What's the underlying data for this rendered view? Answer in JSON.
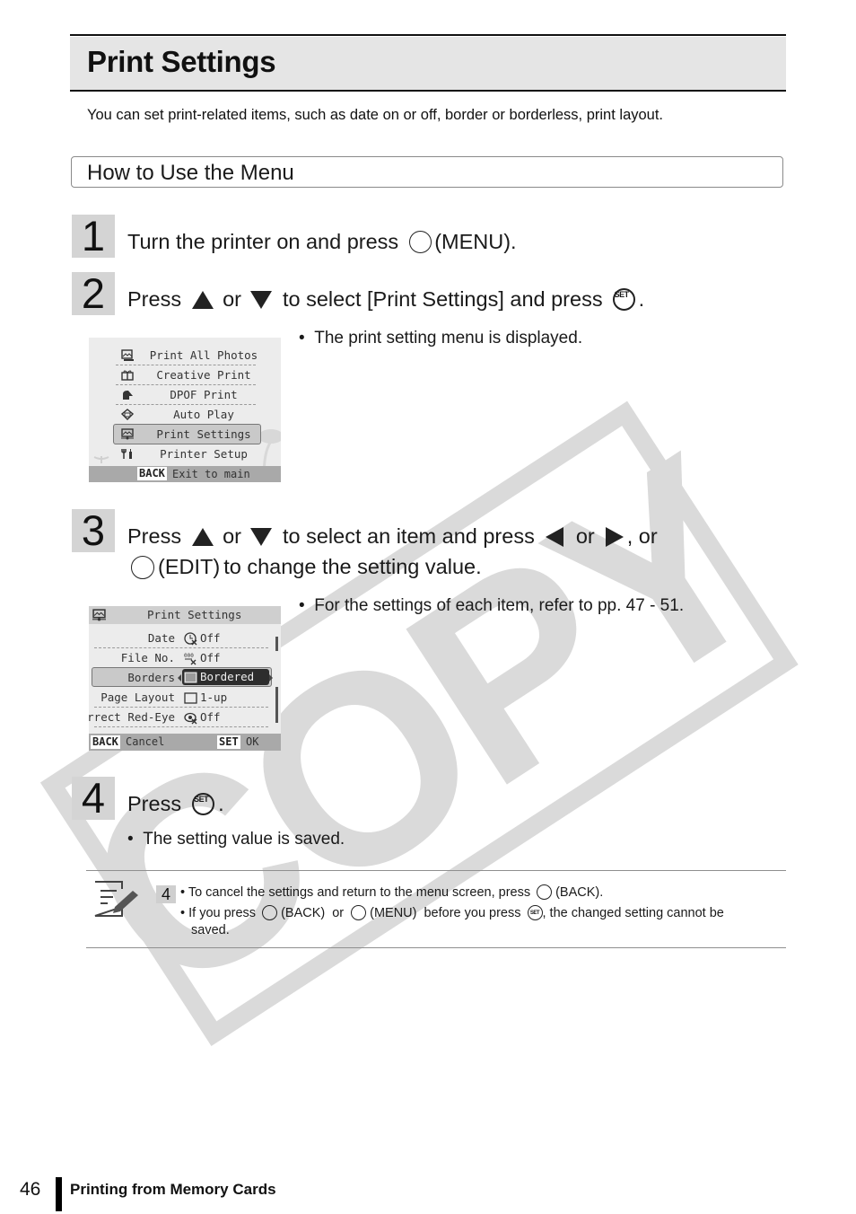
{
  "page": {
    "title": "Print Settings",
    "intro": "You can set print-related items, such as date on or off, border or borderless, print layout.",
    "section_title": "How to Use the Menu",
    "watermark": "COPY"
  },
  "steps": [
    {
      "number": "1",
      "parts": {
        "a": "Turn the printer on and press",
        "button_icon": "circle-button-icon",
        "b": "(MENU)."
      }
    },
    {
      "number": "2",
      "parts": {
        "a": "Press",
        "up_icon": "up-arrow-icon",
        "or1": "or",
        "down_icon": "down-arrow-icon",
        "b": "to select [Print Settings] and press",
        "set_icon": "set-button-icon",
        "c": "."
      },
      "bullet": "The print setting menu is displayed."
    },
    {
      "number": "3",
      "parts": {
        "a": "Press",
        "or1": "or",
        "b": "to select an item and press",
        "or2": "or",
        "c": ", or",
        "d": "(EDIT)",
        "e": "to change the setting value."
      },
      "bullet": "For the settings of each item, refer to pp. 47 - 51."
    },
    {
      "number": "4",
      "parts": {
        "a": "Press",
        "c": "."
      },
      "bullet": "The setting value is saved."
    }
  ],
  "screen1": {
    "items": [
      {
        "label": "Print All Photos",
        "icon": "photos-icon"
      },
      {
        "label": "Creative Print",
        "icon": "gift-icon"
      },
      {
        "label": "DPOF Print",
        "icon": "dpof-icon"
      },
      {
        "label": "Auto Play",
        "icon": "auto-play-icon"
      },
      {
        "label": "Print Settings",
        "icon": "print-settings-icon",
        "selected": true
      },
      {
        "label": "Printer Setup",
        "icon": "tools-icon"
      }
    ],
    "footer_key": "BACK",
    "footer_text": "Exit to main display"
  },
  "screen2": {
    "title": "Print Settings",
    "rows": [
      {
        "label": "Date",
        "value": "Off",
        "icon": "date-off-icon"
      },
      {
        "label": "File No.",
        "value": "Off",
        "icon": "file-no-off-icon"
      },
      {
        "label": "Borders",
        "value": "Bordered",
        "icon": "bordered-icon",
        "selected": true
      },
      {
        "label": "Page Layout",
        "value": "1-up",
        "icon": "layout-1up-icon"
      },
      {
        "label": "Correct Red-Eye",
        "value": "Off",
        "icon": "red-eye-off-icon"
      }
    ],
    "footer_left_key": "BACK",
    "footer_left_text": "Cancel",
    "footer_right_key": "SET",
    "footer_right_text": "OK"
  },
  "note": {
    "ref_step": "4",
    "line1_a": "• To cancel the settings and return to the menu screen, press",
    "line1_b": "(BACK).",
    "line2_a": "• If you press",
    "line2_b": "(BACK)",
    "line2_c": "or",
    "line2_d": "(MENU)",
    "line2_e": "before you press",
    "line2_f": ", the changed setting cannot be",
    "line3": "saved."
  },
  "icons": {
    "set_label": "SET"
  },
  "footer": {
    "page_number": "46",
    "chapter": "Printing from Memory Cards"
  },
  "colors": {
    "title_bar": "#e5e5e5",
    "step_number_bg": "#d4d4d4",
    "watermark": "#d9d9d9",
    "text": "#1a1a1a"
  }
}
